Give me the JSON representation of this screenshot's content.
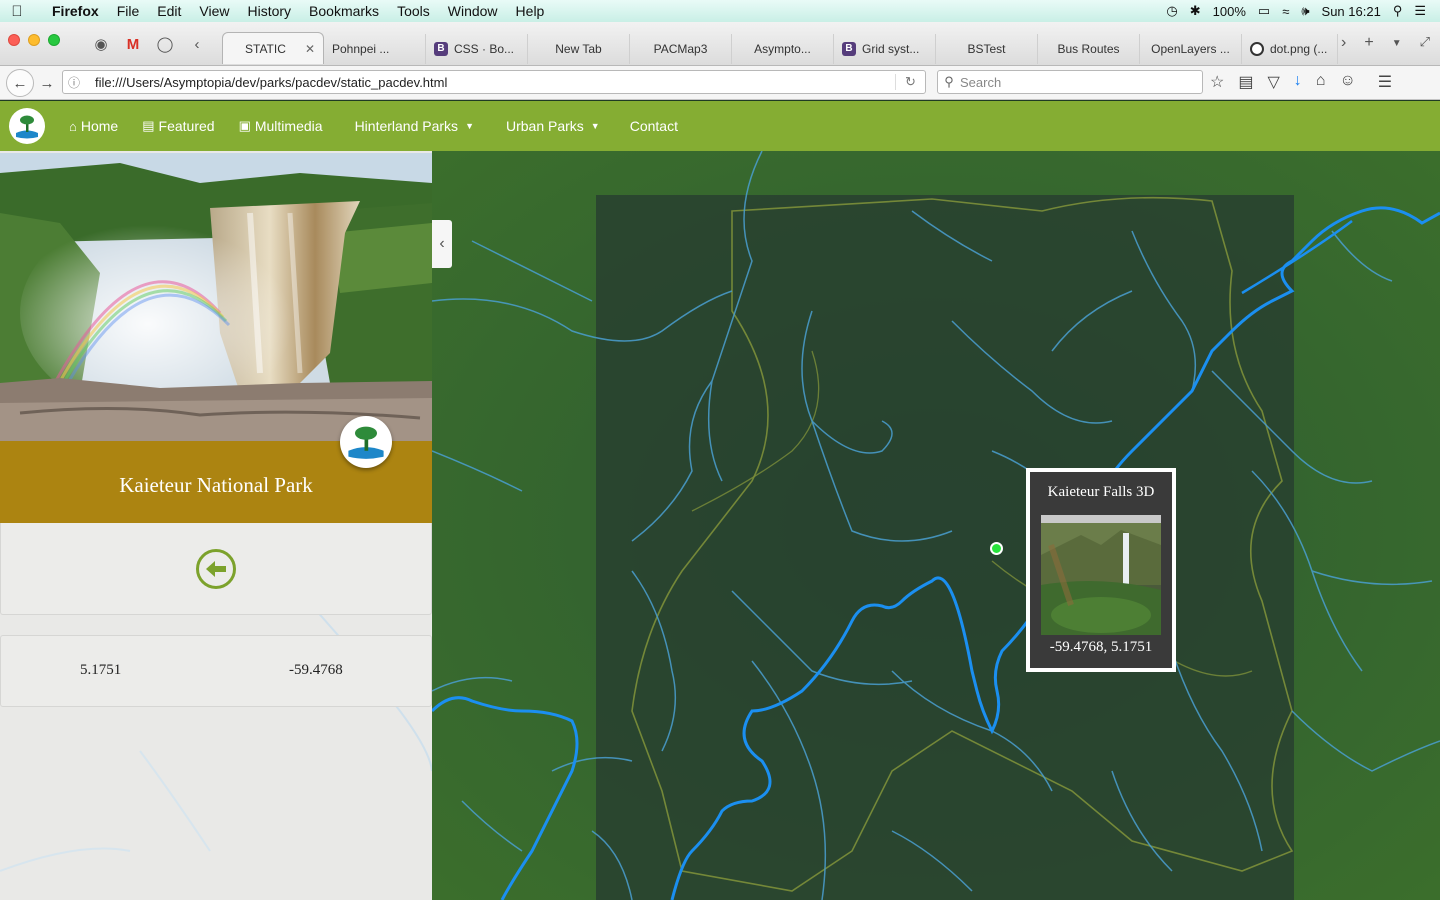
{
  "menubar": {
    "app": "Firefox",
    "items": [
      "File",
      "Edit",
      "View",
      "History",
      "Bookmarks",
      "Tools",
      "Window",
      "Help"
    ],
    "battery": "100%",
    "clock": "Sun 16:21"
  },
  "tabs": [
    {
      "label": "STATIC",
      "active": true
    },
    {
      "label": "Pohnpei ...",
      "icon": "maps-icon"
    },
    {
      "label": "CSS · Bo...",
      "icon": "bootstrap-icon"
    },
    {
      "label": "New Tab"
    },
    {
      "label": "PACMap3"
    },
    {
      "label": "Asympto..."
    },
    {
      "label": "Grid syst...",
      "icon": "bootstrap-icon"
    },
    {
      "label": "BSTest"
    },
    {
      "label": "Bus Routes"
    },
    {
      "label": "OpenLayers ..."
    },
    {
      "label": "dot.png (...",
      "icon": "ring-icon"
    }
  ],
  "toolbar": {
    "url": "file:///Users/Asymptopia/dev/parks/pacdev/static_pacdev.html",
    "search_placeholder": "Search"
  },
  "site_nav": {
    "home": "Home",
    "featured": "Featured",
    "multimedia": "Multimedia",
    "hinterland": "Hinterland Parks",
    "urban": "Urban Parks",
    "contact": "Contact"
  },
  "sidebar": {
    "park_name": "Kaieteur National Park",
    "latitude": "5.1751",
    "longitude": "-59.4768"
  },
  "popup": {
    "title": "Kaieteur Falls 3D",
    "coords": "-59.4768, 5.1751"
  },
  "colors": {
    "nav_green": "#85ad33",
    "title_gold": "#ac8411",
    "river_blue": "#2196f3",
    "marker_green": "#27e43c"
  }
}
